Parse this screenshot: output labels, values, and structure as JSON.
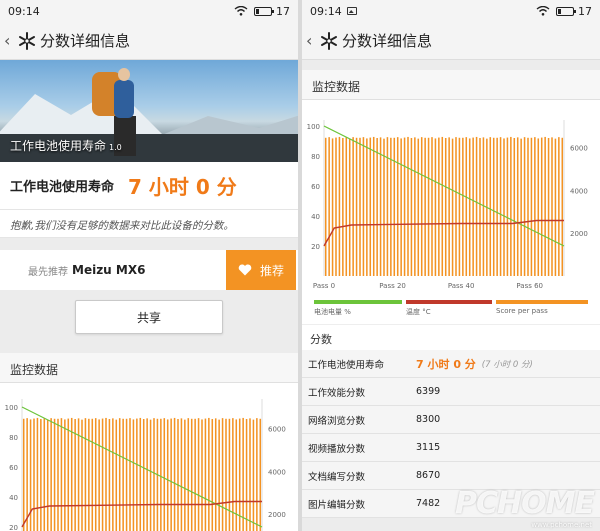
{
  "status_left": {
    "time": "09:14",
    "battery": "17"
  },
  "status_right": {
    "time": "09:14",
    "battery": "17"
  },
  "appbar": {
    "title": "分数详细信息"
  },
  "hero": {
    "caption": "工作电池使用寿命",
    "version": "1.0"
  },
  "score": {
    "label": "工作电池使用寿命",
    "value": "7 小时 0 分"
  },
  "note": "抱歉,我们没有足够的数据来对比此设备的分数。",
  "recommend": {
    "prefix": "最先推荐",
    "device": "Meizu MX6",
    "button": "推荐"
  },
  "share": {
    "label": "共享"
  },
  "monitor": {
    "title": "监控数据"
  },
  "legend": {
    "battery": "电池电量 %",
    "temp": "温度 °C",
    "score": "Score per pass"
  },
  "scores": {
    "title": "分数",
    "rows": [
      {
        "label": "工作电池使用寿命",
        "value": "7 小时 0 分",
        "sub": "(7 小时 0 分)"
      },
      {
        "label": "工作效能分数",
        "value": "6399"
      },
      {
        "label": "网络浏览分数",
        "value": "8300"
      },
      {
        "label": "视频播放分数",
        "value": "3115"
      },
      {
        "label": "文档编写分数",
        "value": "8670"
      },
      {
        "label": "图片编辑分数",
        "value": "7482"
      }
    ]
  },
  "watermark": {
    "text": "PCHOME",
    "sub": "www.pchome.net"
  },
  "colors": {
    "accent": "#f07a18",
    "battery": "#6cc43a",
    "temp": "#c0392b",
    "score": "#f39323"
  },
  "chart_data": {
    "type": "bar",
    "x_ticks": [
      "Pass 0",
      "Pass 20",
      "Pass 40",
      "Pass 60"
    ],
    "left_ticks": [
      100,
      80,
      60,
      40,
      20
    ],
    "right_ticks": [
      6000,
      4000,
      2000
    ],
    "ylim_left": [
      0,
      100
    ],
    "ylim_right": [
      0,
      7000
    ],
    "series": [
      {
        "name": "Score per pass",
        "axis": "right",
        "type": "bar",
        "pass_count": 70,
        "values": [
          6450,
          6480,
          6420,
          6460,
          6490,
          6440,
          6470,
          6410,
          6480,
          6450
        ]
      },
      {
        "name": "电池电量 %",
        "axis": "left",
        "type": "line",
        "x": [
          0,
          70
        ],
        "values": [
          100,
          20
        ]
      },
      {
        "name": "温度 °C",
        "axis": "left",
        "type": "line",
        "x": [
          0,
          3,
          8,
          40,
          55,
          62,
          70
        ],
        "values": [
          20,
          32,
          34,
          35,
          35,
          37,
          37
        ]
      }
    ]
  }
}
